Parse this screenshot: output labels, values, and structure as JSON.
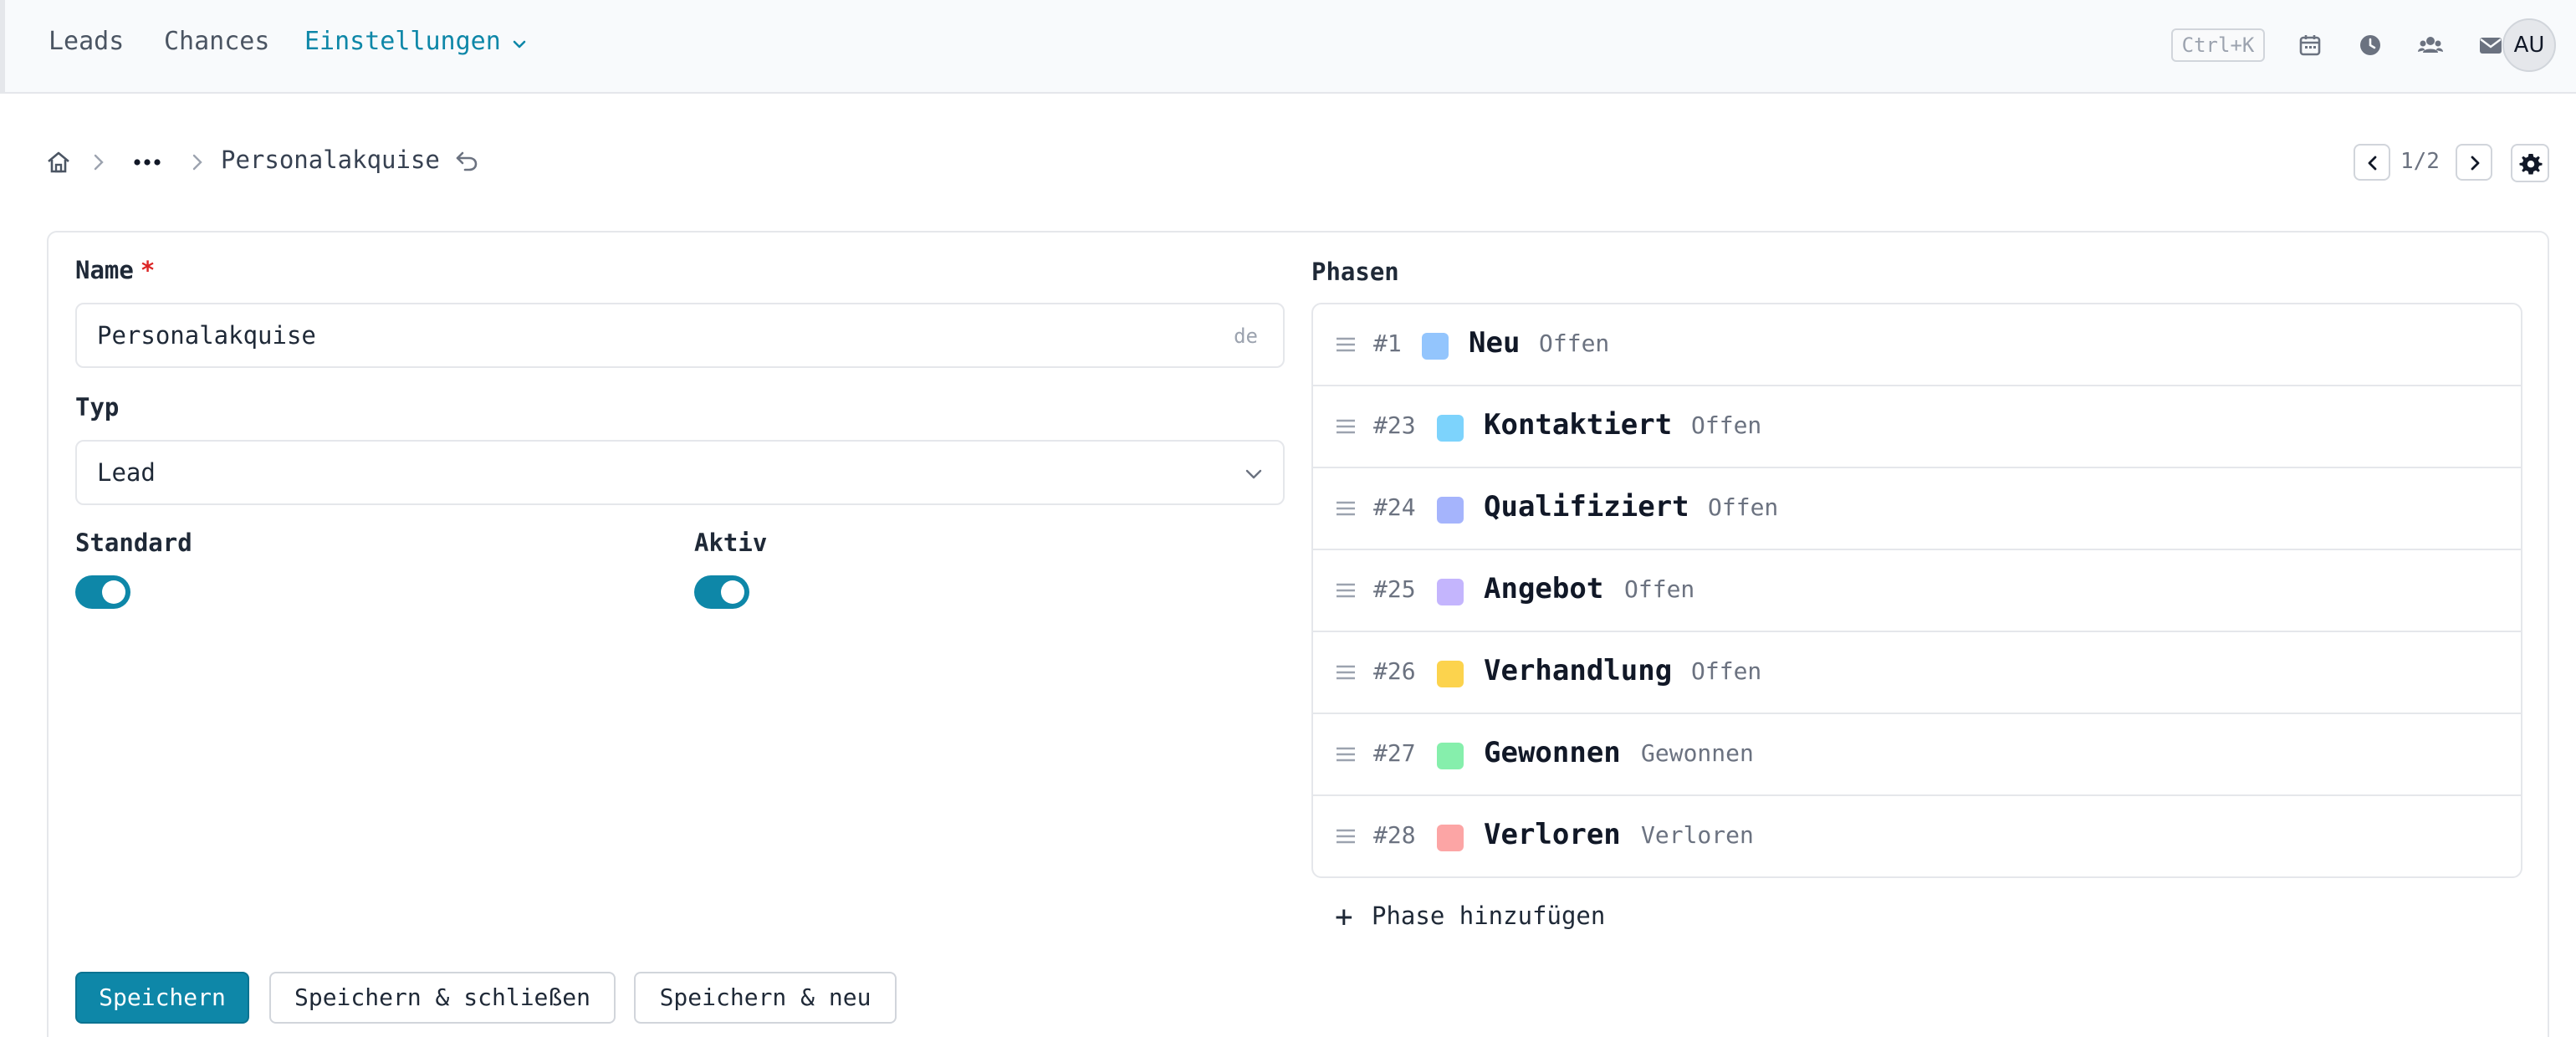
{
  "topbar": {
    "nav": [
      {
        "label": "Leads"
      },
      {
        "label": "Chances"
      },
      {
        "label": "Einstellungen"
      }
    ],
    "shortcut": "Ctrl+K",
    "icons": [
      "calendar-icon",
      "clock-icon",
      "users-icon",
      "mail-icon"
    ],
    "avatar": "AU"
  },
  "breadcrumb": {
    "title": "Personalakquise",
    "pager": "1/2"
  },
  "form": {
    "name_label": "Name",
    "required_mark": "*",
    "name_value": "Personalakquise",
    "name_lang": "de",
    "type_label": "Typ",
    "type_value": "Lead",
    "standard_label": "Standard",
    "standard_on": true,
    "active_label": "Aktiv",
    "active_on": true
  },
  "phases": {
    "label": "Phasen",
    "items": [
      {
        "id": "#1",
        "name": "Neu",
        "status": "Offen",
        "color": "#93c5fd"
      },
      {
        "id": "#23",
        "name": "Kontaktiert",
        "status": "Offen",
        "color": "#7dd3fc"
      },
      {
        "id": "#24",
        "name": "Qualifiziert",
        "status": "Offen",
        "color": "#a5b4fc"
      },
      {
        "id": "#25",
        "name": "Angebot",
        "status": "Offen",
        "color": "#c4b5fd"
      },
      {
        "id": "#26",
        "name": "Verhandlung",
        "status": "Offen",
        "color": "#fcd34d"
      },
      {
        "id": "#27",
        "name": "Gewonnen",
        "status": "Gewonnen",
        "color": "#86efac"
      },
      {
        "id": "#28",
        "name": "Verloren",
        "status": "Verloren",
        "color": "#fca5a5"
      }
    ],
    "add_label": "Phase hinzufügen"
  },
  "actions": {
    "save": "Speichern",
    "save_close": "Speichern & schließen",
    "save_new": "Speichern & neu"
  },
  "colors": {
    "accent": "#0e87a8"
  }
}
